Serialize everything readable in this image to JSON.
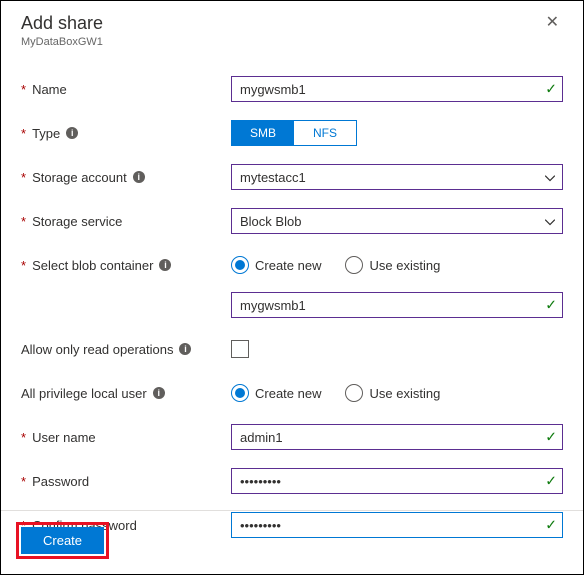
{
  "header": {
    "title": "Add share",
    "subtitle": "MyDataBoxGW1"
  },
  "labels": {
    "name": "Name",
    "type": "Type",
    "storage_account": "Storage account",
    "storage_service": "Storage service",
    "select_blob_container": "Select blob container",
    "allow_read": "Allow only read operations",
    "all_privilege_user": "All privilege local user",
    "user_name": "User name",
    "password": "Password",
    "confirm_password": "Confirm password"
  },
  "values": {
    "name": "mygwsmb1",
    "storage_account": "mytestacc1",
    "storage_service": "Block Blob",
    "container_name": "mygwsmb1",
    "user_name": "admin1",
    "password": "•••••••••",
    "confirm_password": "•••••••••"
  },
  "type_toggle": {
    "options": [
      "SMB",
      "NFS"
    ],
    "selected": "SMB"
  },
  "radio_options": {
    "create_new": "Create new",
    "use_existing": "Use existing"
  },
  "footer": {
    "create": "Create"
  }
}
